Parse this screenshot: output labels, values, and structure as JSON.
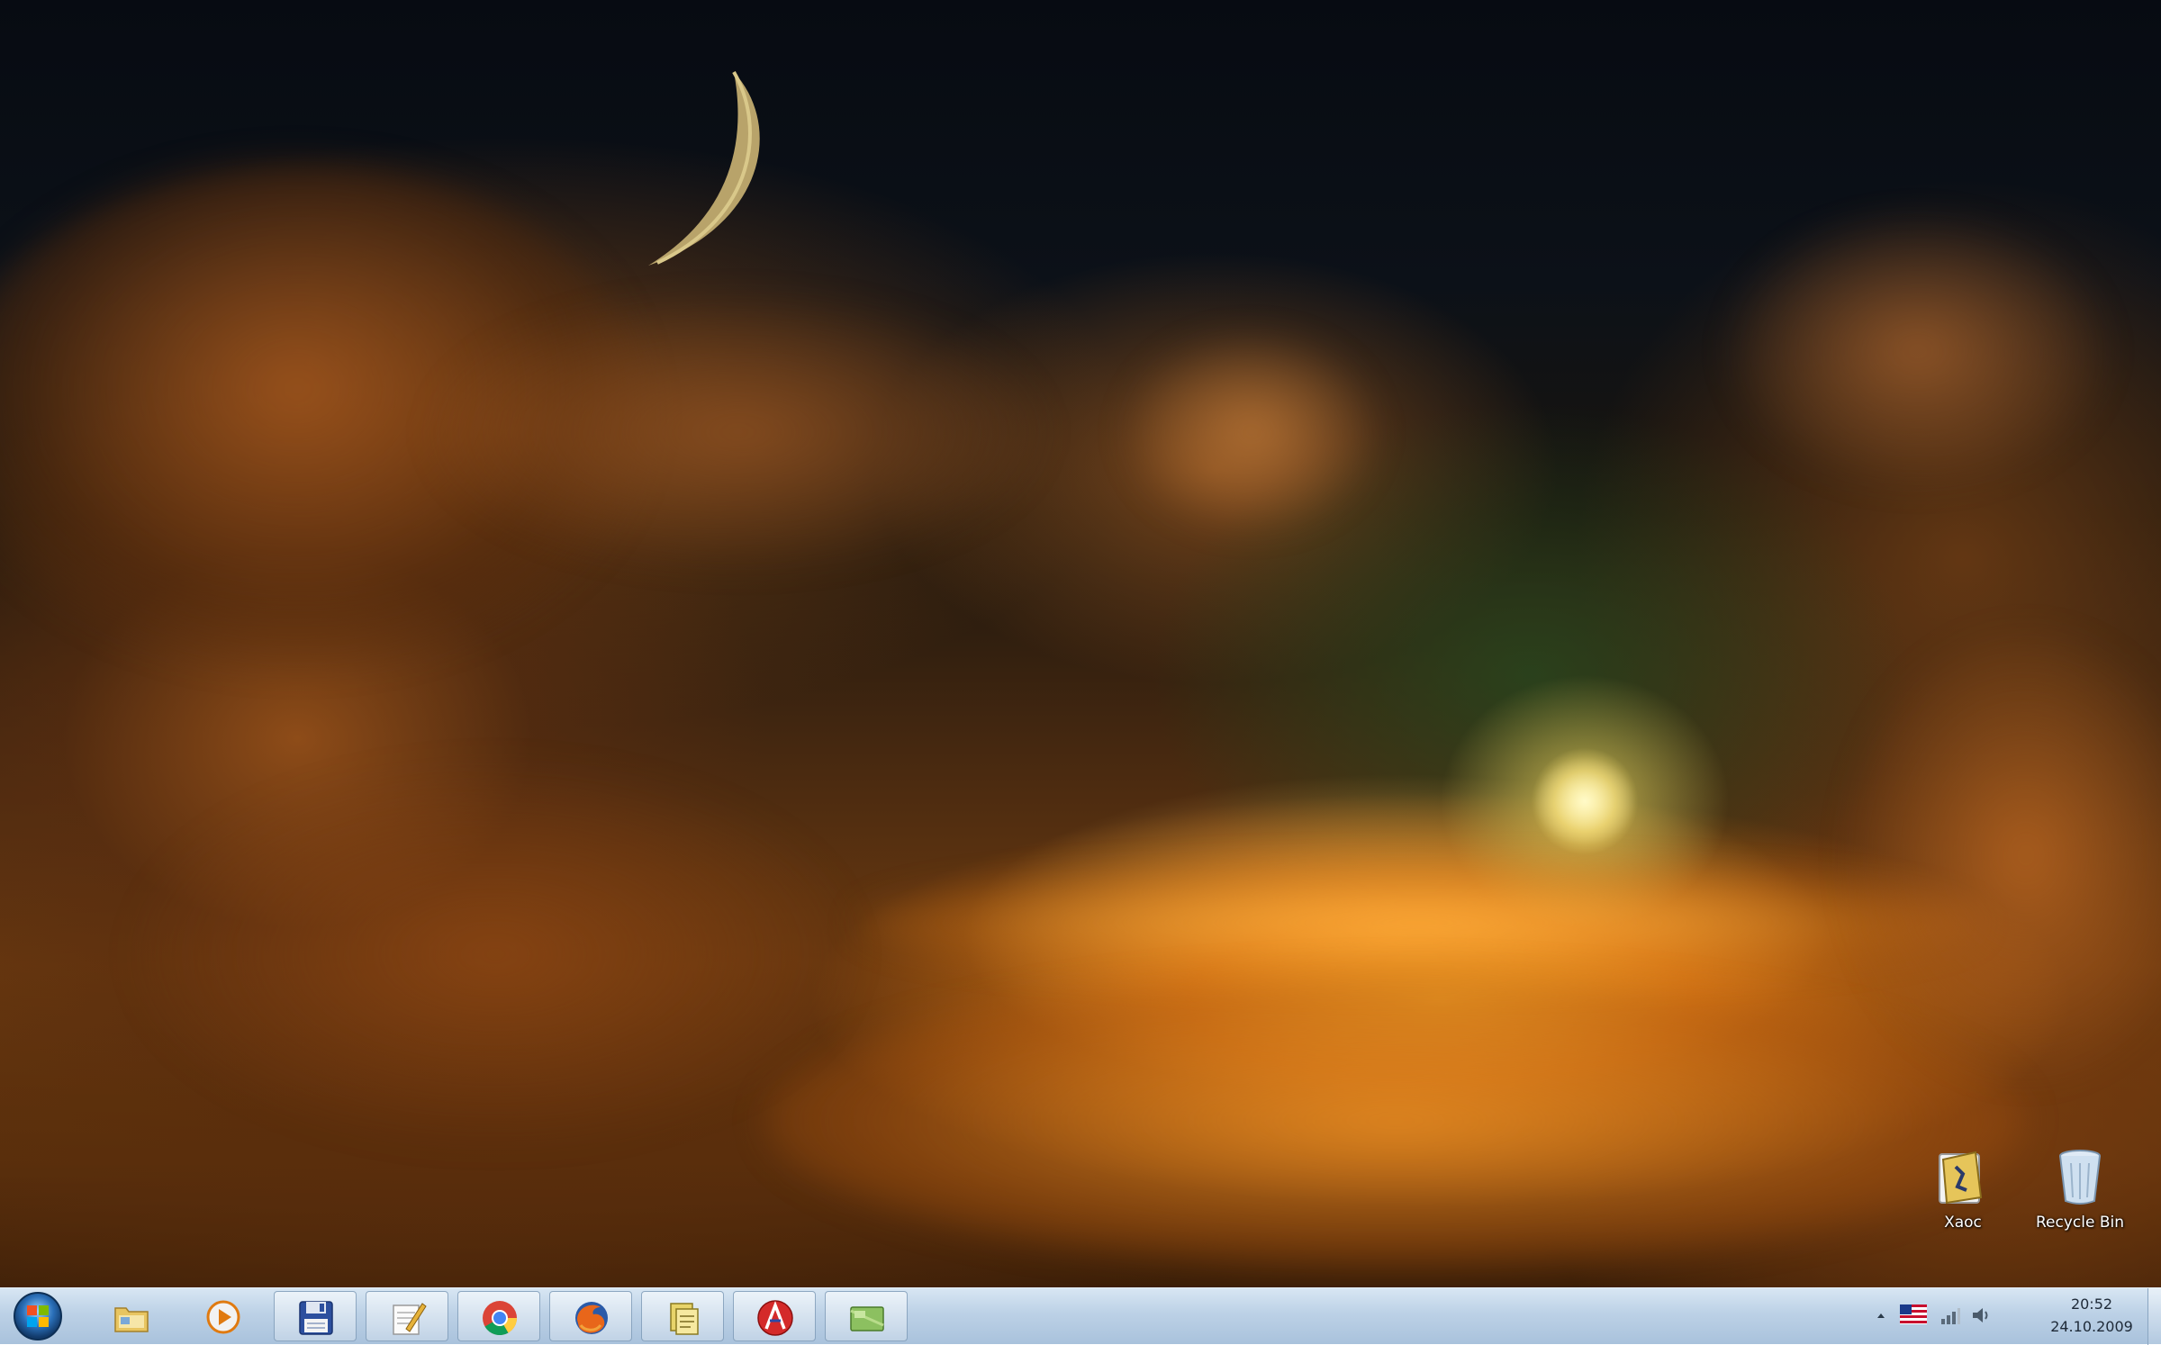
{
  "desktop": {
    "wallpaper": "Sunset above clouds with crescent moon",
    "icons": [
      {
        "label": "Хаос",
        "icon": "folder-icon"
      },
      {
        "label": "Recycle Bin",
        "icon": "recycle-bin-icon"
      }
    ]
  },
  "taskbar": {
    "start_button": "start-orb-icon",
    "pinned": [
      {
        "icon": "windows-explorer-icon",
        "active": false
      },
      {
        "icon": "media-player-icon",
        "active": false
      },
      {
        "icon": "floppy-save-icon",
        "active": true
      },
      {
        "icon": "notepad-pencil-icon",
        "active": true
      },
      {
        "icon": "chrome-icon",
        "active": true
      },
      {
        "icon": "firefox-icon",
        "active": true
      },
      {
        "icon": "file-manager-icon",
        "active": true
      },
      {
        "icon": "red-a-app-icon",
        "active": true
      },
      {
        "icon": "green-app-icon",
        "active": true
      }
    ],
    "tray": {
      "icons": [
        "show-hidden-icons-arrow",
        "language-flag-icon",
        "network-icon",
        "volume-icon"
      ],
      "time": "20:52",
      "date": "24.10.2009"
    }
  },
  "colors": {
    "taskbar_top": "#d8e6f3",
    "taskbar_bottom": "#a9c2dc",
    "sky": "#0c1118",
    "cloud_glow": "#f0961e"
  }
}
